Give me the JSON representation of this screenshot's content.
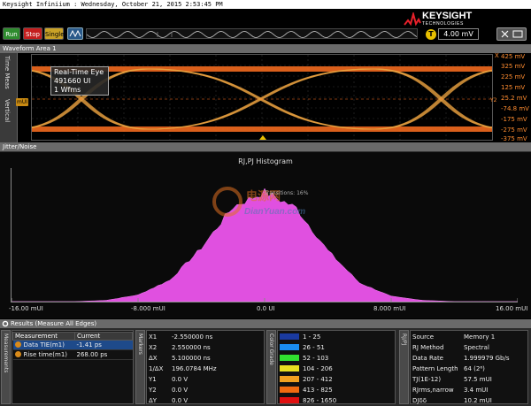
{
  "title_bar": {
    "text": "Keysight Infiniium : Wednesday, October 21, 2015 2:53:45 PM"
  },
  "toolbar": {
    "run": "Run",
    "stop": "Stop",
    "single": "Single",
    "trigger_icon": "T",
    "trigger_level": "4.00 mV"
  },
  "logo": {
    "name": "KEYSIGHT",
    "sub": "TECHNOLOGIES"
  },
  "waveform": {
    "header": "Waveform Area 1",
    "side_tab_top": "Time Meas",
    "side_tab_bottom": "Vertical",
    "info_box": {
      "line1": "Real-Time Eye",
      "line2": "491660 UI",
      "line3": "1 Wfms"
    },
    "marker_tag": "mUI",
    "x_marker": "X",
    "y2_marker": "Y2",
    "y_ticks": [
      "425 mV",
      "325 mV",
      "225 mV",
      "125 mV",
      "25.2 mV",
      "-74.8 mV",
      "-175 mV",
      "-275 mV",
      "-375 mV"
    ],
    "colors": {
      "eye": "#e8a040",
      "rails": "#ff7020",
      "grid": "#333333"
    }
  },
  "jitter": {
    "header": "Jitter/Noise",
    "title": "RJ,PJ Histogram",
    "transitions_label": "Transitions: 16%",
    "x_ticks": [
      "-16.00 mUI",
      "-8.000 mUI",
      "0.0 UI",
      "8.000 mUI",
      "16.00 mUI"
    ],
    "hist_color": "#e050e0",
    "chart_data": {
      "type": "area",
      "title": "RJ,PJ Histogram",
      "xlabel": "",
      "ylabel": "",
      "xlim": [
        -16,
        16
      ],
      "x": [
        -16,
        -14,
        -12,
        -10,
        -8,
        -6,
        -4,
        -2,
        0,
        2,
        4,
        6,
        8,
        10,
        12,
        14,
        16
      ],
      "values": [
        0.0,
        0.0,
        0.0,
        0.01,
        0.05,
        0.16,
        0.4,
        0.71,
        0.82,
        0.7,
        0.38,
        0.14,
        0.04,
        0.01,
        0.0,
        0.0,
        0.0
      ],
      "ylim": [
        0,
        1
      ],
      "legend": "none",
      "grid": false
    }
  },
  "watermark": {
    "cn": "电源网",
    "en": "DianYuan.com"
  },
  "results": {
    "header": "Results  (Measure All Edges)",
    "tabs": {
      "measurements": "Measurements",
      "markers": "Markers",
      "color_grade": "Color Grade",
      "rj_pj": "RJ/PJ"
    },
    "meas_columns": [
      "Measurement",
      "Current"
    ],
    "meas_rows": [
      {
        "name": "Data TIE(m1)",
        "value": "-1.41 ps"
      },
      {
        "name": "Rise time(m1)",
        "value": "268.00 ps"
      }
    ],
    "markers": [
      {
        "k": "X1",
        "v": "-2.550000 ns"
      },
      {
        "k": "X2",
        "v": "2.550000 ns"
      },
      {
        "k": "ΔX",
        "v": "5.100000 ns"
      },
      {
        "k": "1/ΔX",
        "v": "196.0784 MHz"
      },
      {
        "k": "Y1",
        "v": "0.0 V"
      },
      {
        "k": "Y2",
        "v": "0.0 V"
      },
      {
        "k": "ΔY",
        "v": "0.0 V"
      }
    ],
    "color_grade": [
      {
        "range": "1 - 25",
        "color": "#1a3aa0"
      },
      {
        "range": "26 - 51",
        "color": "#1a8cf0"
      },
      {
        "range": "52 - 103",
        "color": "#30e030"
      },
      {
        "range": "104 - 206",
        "color": "#e8e020"
      },
      {
        "range": "207 - 412",
        "color": "#f0a020"
      },
      {
        "range": "413 - 825",
        "color": "#f06a10"
      },
      {
        "range": "826 - 1650",
        "color": "#e01010"
      }
    ],
    "rj_pj": [
      {
        "k": "Source",
        "v": "Memory 1"
      },
      {
        "k": "RJ Method",
        "v": "Spectral"
      },
      {
        "k": "Data Rate",
        "v": "1.999979 Gb/s"
      },
      {
        "k": "Pattern Length",
        "v": "64 (2⁶)"
      },
      {
        "k": "TJ(1E-12)",
        "v": "57.5 mUI"
      },
      {
        "k": "RJrms,narrow",
        "v": "3.4 mUI"
      },
      {
        "k": "DJδδ",
        "v": "10.2 mUI"
      }
    ]
  }
}
